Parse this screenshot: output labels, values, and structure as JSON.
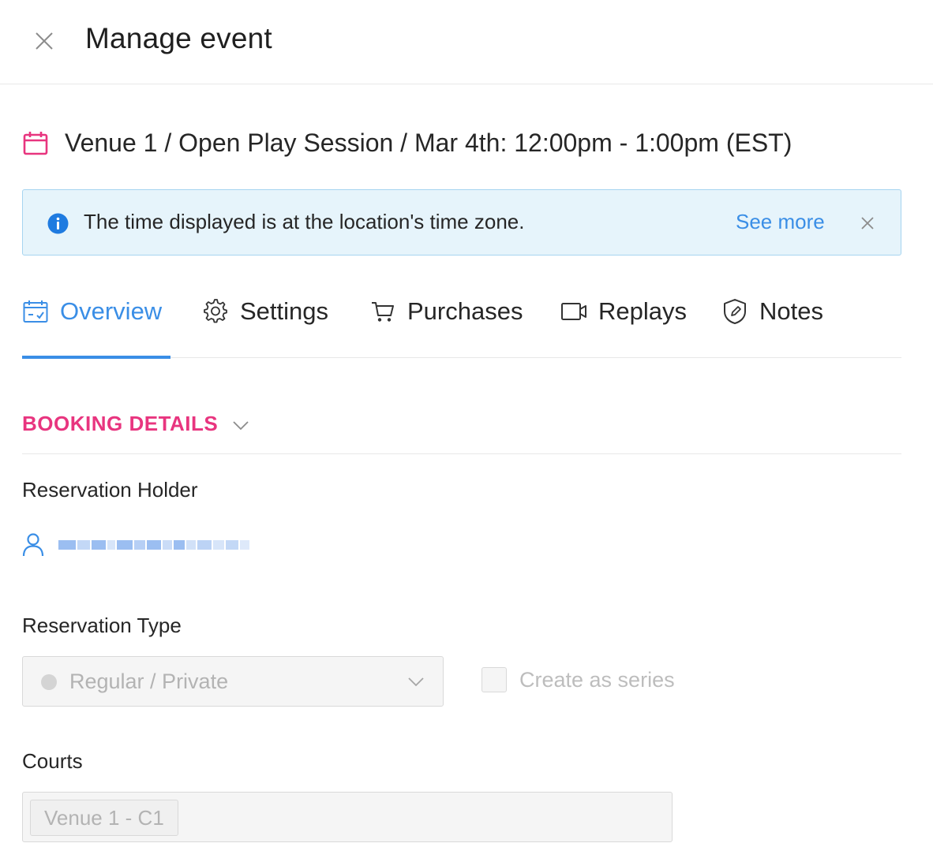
{
  "header": {
    "title": "Manage event",
    "close_icon": "close-icon"
  },
  "event": {
    "icon": "calendar-icon",
    "title": "Venue 1 / Open Play Session / Mar 4th: 12:00pm - 1:00pm (EST)"
  },
  "alert": {
    "icon": "info-icon",
    "text": "The time displayed is at the location's time zone.",
    "link": "See more",
    "close_icon": "close-icon"
  },
  "tabs": [
    {
      "label": "Overview",
      "icon": "calendar-check-icon",
      "active": true
    },
    {
      "label": "Settings",
      "icon": "gear-icon",
      "active": false
    },
    {
      "label": "Purchases",
      "icon": "cart-icon",
      "active": false
    },
    {
      "label": "Replays",
      "icon": "video-camera-icon",
      "active": false
    },
    {
      "label": "Notes",
      "icon": "shield-note-icon",
      "active": false
    }
  ],
  "booking": {
    "section_title": "BOOKING DETAILS",
    "holder_label": "Reservation Holder",
    "holder_icon": "user-icon",
    "type_label": "Reservation Type",
    "type_value": "Regular / Private",
    "series_label": "Create as series",
    "courts_label": "Courts",
    "courts": [
      "Venue 1 - C1"
    ]
  },
  "colors": {
    "accent": "#3a8ee6",
    "section": "#e8357f",
    "alert_bg": "#e6f4fb",
    "alert_border": "#a6d4f0"
  }
}
